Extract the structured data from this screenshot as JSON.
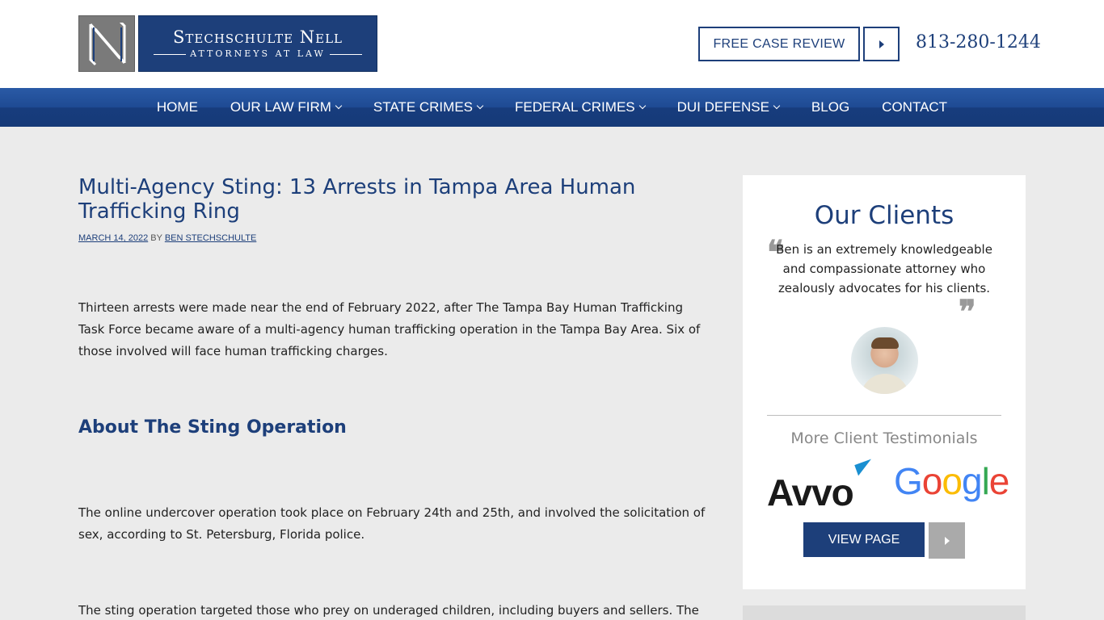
{
  "header": {
    "logo_name": "Stechschulte Nell",
    "logo_sub": "ATTORNEYS AT LAW",
    "review_button": "FREE CASE REVIEW",
    "phone": "813-280-1244"
  },
  "nav": {
    "items": [
      {
        "label": "HOME",
        "dropdown": false
      },
      {
        "label": "OUR LAW FIRM",
        "dropdown": true
      },
      {
        "label": "STATE CRIMES",
        "dropdown": true
      },
      {
        "label": "FEDERAL CRIMES",
        "dropdown": true
      },
      {
        "label": "DUI DEFENSE",
        "dropdown": true
      },
      {
        "label": "BLOG",
        "dropdown": false
      },
      {
        "label": "CONTACT",
        "dropdown": false
      }
    ]
  },
  "article": {
    "title": "Multi-Agency Sting: 13 Arrests in Tampa Area Human Trafficking Ring",
    "date": "MARCH 14, 2022",
    "by": "BY",
    "author": "BEN STECHSCHULTE",
    "p1": "Thirteen arrests were made near the end of February 2022, after The Tampa Bay Human Trafficking Task Force became aware of a multi-agency human trafficking operation in the Tampa Bay Area. Six of those involved will face human trafficking charges.",
    "h2": "About The Sting Operation",
    "p2": "The online undercover operation took place on February 24th and 25th, and involved the solicitation of sex, according to St. Petersburg, Florida police.",
    "p3": "The sting operation targeted those who prey on underaged children, including buyers and sellers. The"
  },
  "sidebar": {
    "title": "Our Clients",
    "quote": "Ben is an extremely knowledgeable and compassionate attorney who zealously advocates for his clients.",
    "more_title": "More Client Testimonials",
    "avvo_logo": "Avvo",
    "google_logo": "Google",
    "view_button": "VIEW PAGE"
  },
  "colors": {
    "brand_blue": "#1d3f7a",
    "nav_blue": "#1e4a93",
    "background": "#ebebeb"
  }
}
